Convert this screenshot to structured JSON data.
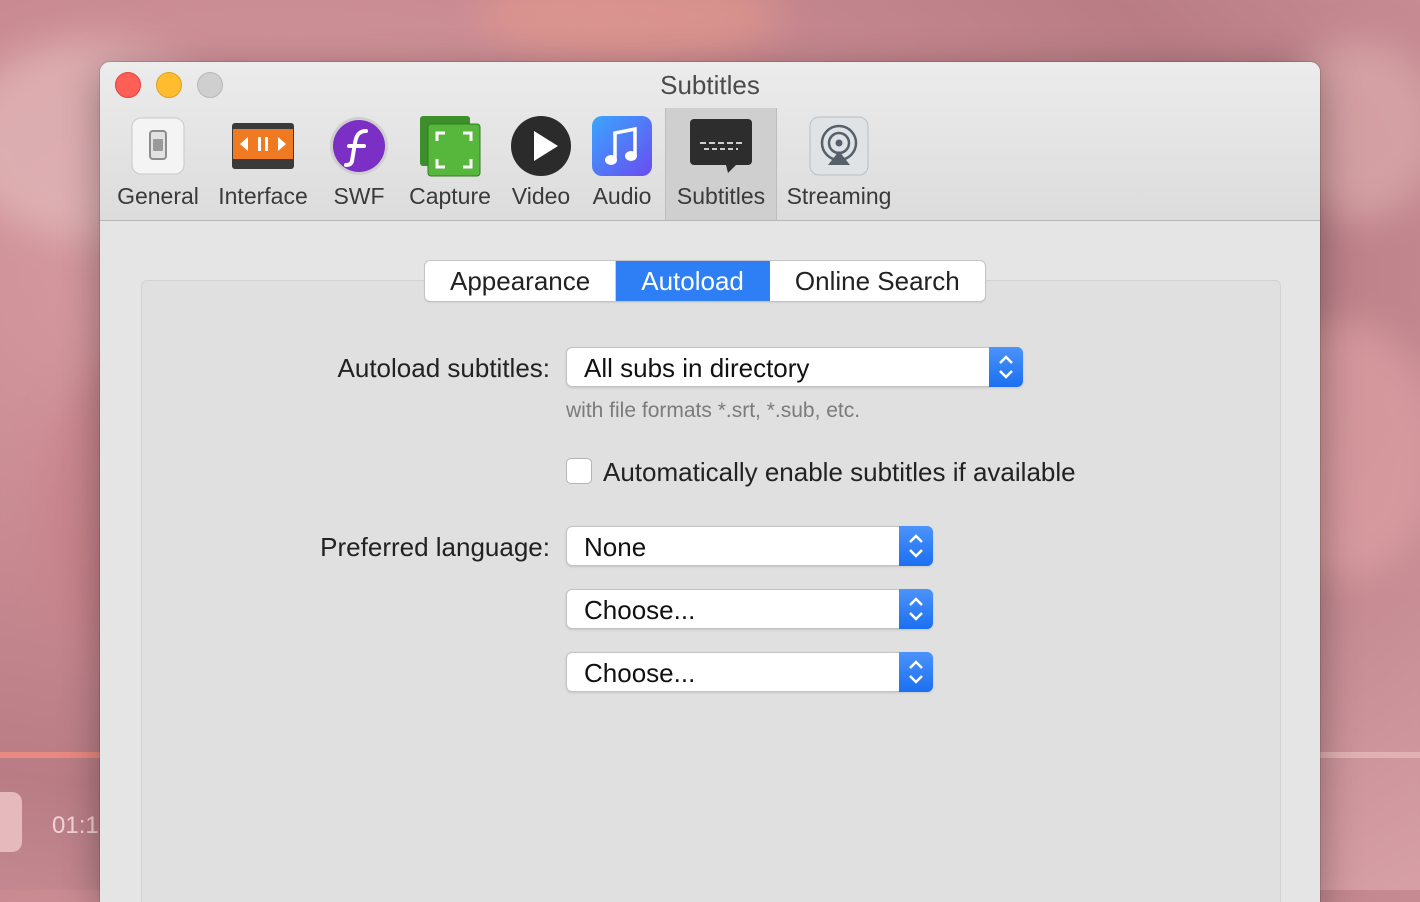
{
  "window": {
    "title": "Subtitles"
  },
  "toolbar": {
    "items": [
      {
        "label": "General",
        "icon": "general-switch-icon"
      },
      {
        "label": "Interface",
        "icon": "interface-controls-icon"
      },
      {
        "label": "SWF",
        "icon": "flash-icon"
      },
      {
        "label": "Capture",
        "icon": "capture-icon"
      },
      {
        "label": "Video",
        "icon": "play-icon"
      },
      {
        "label": "Audio",
        "icon": "music-note-icon"
      },
      {
        "label": "Subtitles",
        "icon": "subtitles-icon",
        "selected": true
      },
      {
        "label": "Streaming",
        "icon": "airplay-icon"
      }
    ]
  },
  "tabs": {
    "items": [
      {
        "label": "Appearance"
      },
      {
        "label": "Autoload",
        "active": true
      },
      {
        "label": "Online Search"
      }
    ]
  },
  "form": {
    "autoload_label": "Autoload subtitles:",
    "autoload_value": "All subs in directory",
    "autoload_hint": "with file formats *.srt, *.sub, etc.",
    "auto_enable_label": "Automatically enable subtitles if available",
    "auto_enable_checked": false,
    "preferred_label": "Preferred language:",
    "preferred_values": [
      "None",
      "Choose...",
      "Choose..."
    ]
  },
  "background": {
    "time_text": "01:1"
  },
  "colors": {
    "accent": "#2e7ff5",
    "close": "#fe5f57",
    "minimize": "#febc2e",
    "zoom": "#cfcfcf"
  }
}
